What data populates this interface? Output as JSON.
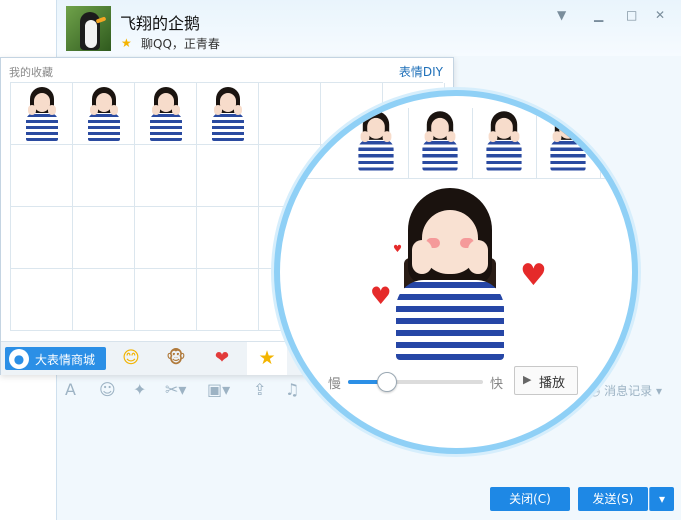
{
  "header": {
    "contact_name": "飞翔的企鹅",
    "status_text": "聊QQ，正青春",
    "window_buttons": [
      "chevron-down-icon",
      "minimize-icon",
      "maximize-icon",
      "close-icon"
    ]
  },
  "toolbar": {
    "icons": [
      "font-icon",
      "emoji-icon",
      "magic-icon",
      "screenshot-icon",
      "image-icon",
      "upload-icon",
      "music-icon"
    ],
    "history_label": "消息记录"
  },
  "buttons": {
    "close_label": "关闭(C)",
    "send_label": "发送(S)"
  },
  "fav_panel": {
    "title": "我的收藏",
    "diy_label": "表情DIY",
    "filled_cells": 4,
    "tabs": {
      "shop_label": "大表情商城",
      "smiley": "😊",
      "monkey": "🐵",
      "heart": "❤",
      "favorites": "★"
    }
  },
  "magnifier": {
    "strip_cells": 4,
    "hearts": [
      "♥",
      "♥",
      "♥"
    ],
    "speed_slow": "慢",
    "speed_fast": "快",
    "speed_level": 0.28,
    "play_icon": "▶",
    "play_label": "播放"
  },
  "colors": {
    "accent": "#1e88e5",
    "magnifier_ring": "#8fd0f6",
    "heart": "#e52a2a"
  }
}
